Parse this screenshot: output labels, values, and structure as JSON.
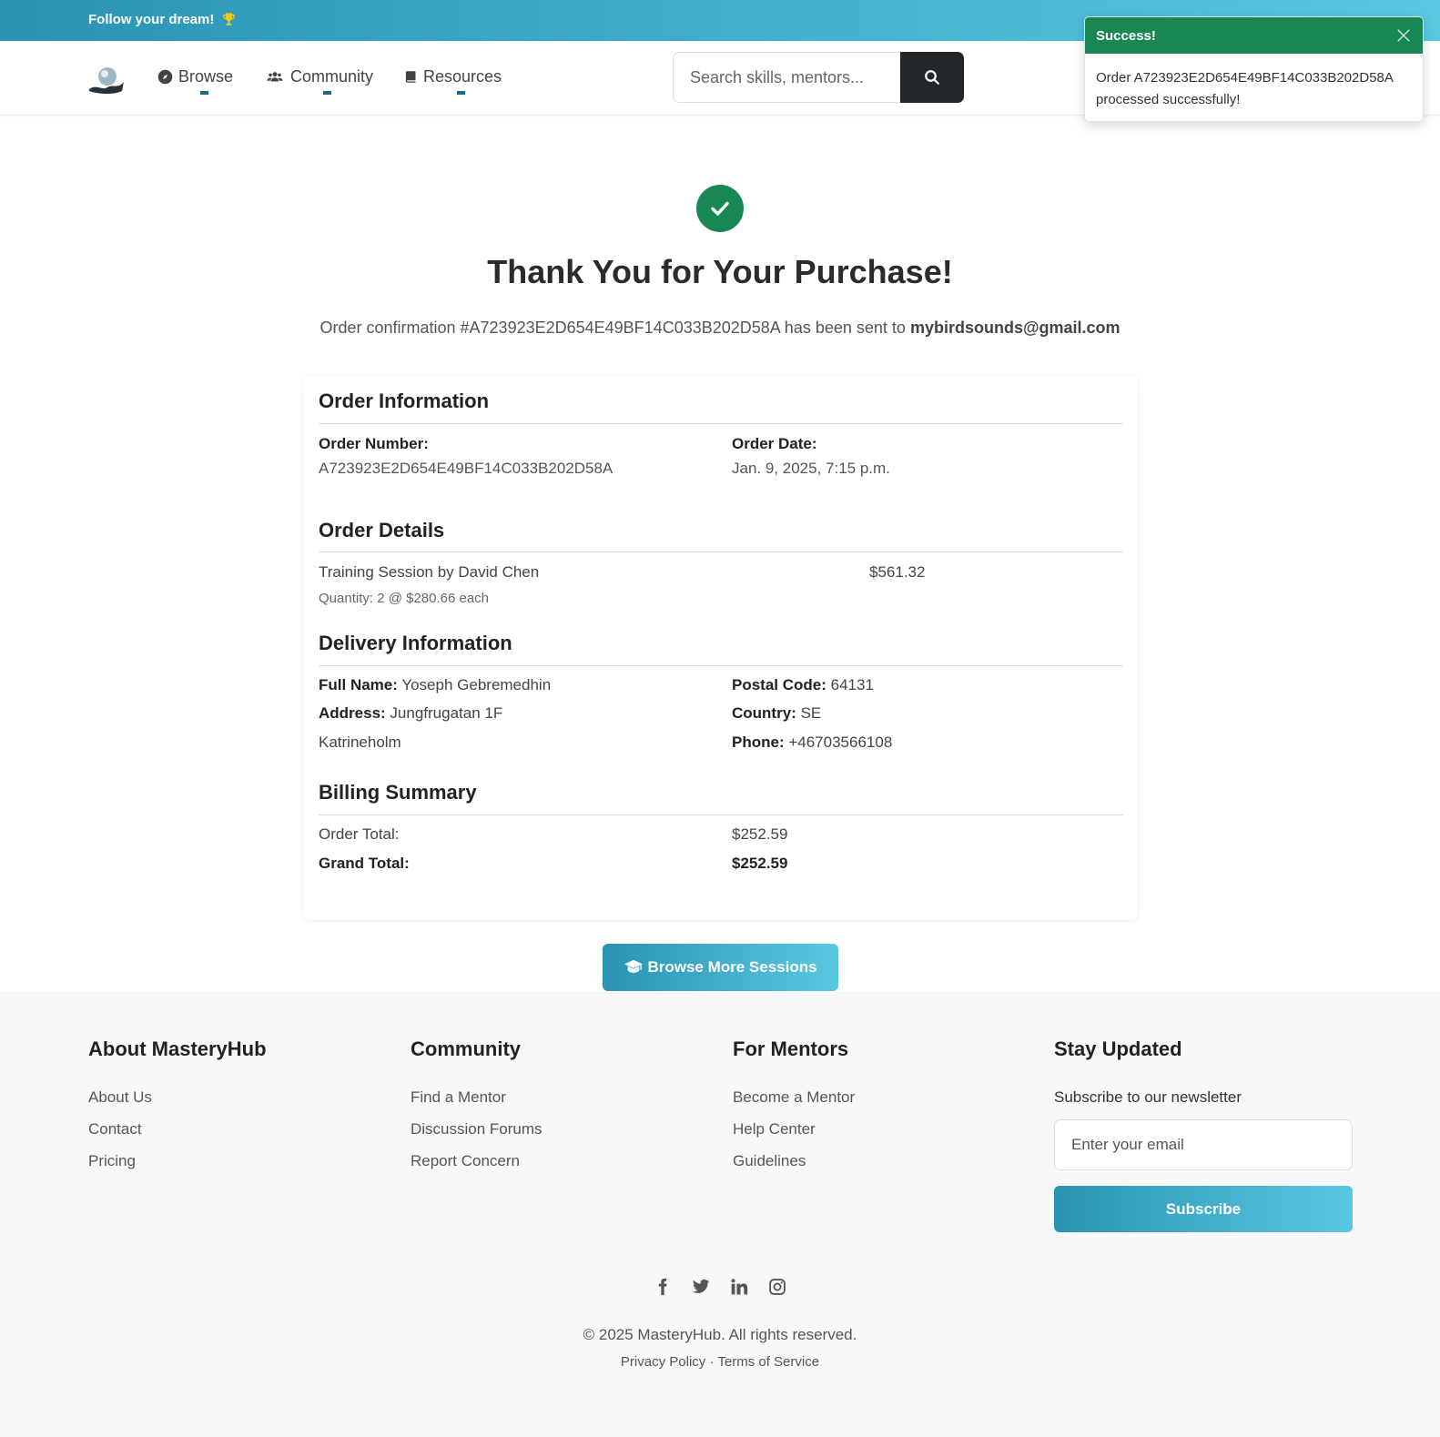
{
  "topbar": {
    "promo_text": "Follow your dream!",
    "trophy_icon": "trophy-icon"
  },
  "nav": {
    "browse": "Browse",
    "community": "Community",
    "resources": "Resources",
    "search_placeholder": "Search skills, mentors..."
  },
  "toast": {
    "title": "Success!",
    "message": "Order A723923E2D654E49BF14C033B202D58A processed successfully!"
  },
  "hero": {
    "title": "Thank You for Your Purchase!",
    "confirm_prefix": "Order confirmation #A723923E2D654E49BF14C033B202D58A has been sent to",
    "email": "mybirdsounds@gmail.com"
  },
  "order_info": {
    "title": "Order Information",
    "number_label": "Order Number:",
    "number": "A723923E2D654E49BF14C033B202D58A",
    "date_label": "Order Date:",
    "date": "Jan. 9, 2025, 7:15 p.m."
  },
  "order_details": {
    "title": "Order Details",
    "item_name": "Training Session by David Chen",
    "item_price": "$561.32",
    "item_qty": "Quantity: 2 @ $280.66 each"
  },
  "delivery": {
    "title": "Delivery Information",
    "full_name_label": "Full Name:",
    "full_name": "Yoseph Gebremedhin",
    "address_label": "Address:",
    "address": "Jungfrugatan 1F",
    "city": "Katrineholm",
    "postal_label": "Postal Code:",
    "postal": "64131",
    "country_label": "Country:",
    "country": "SE",
    "phone_label": "Phone:",
    "phone": "+46703566108"
  },
  "billing": {
    "title": "Billing Summary",
    "order_total_label": "Order Total:",
    "order_total": "$252.59",
    "grand_total_label": "Grand Total:",
    "grand_total": "$252.59"
  },
  "cta": {
    "browse_more": "Browse More Sessions"
  },
  "footer": {
    "about": {
      "title": "About MasteryHub",
      "links": [
        "About Us",
        "Contact",
        "Pricing"
      ]
    },
    "community": {
      "title": "Community",
      "links": [
        "Find a Mentor",
        "Discussion Forums",
        "Report Concern"
      ]
    },
    "mentors": {
      "title": "For Mentors",
      "links": [
        "Become a Mentor",
        "Help Center",
        "Guidelines"
      ]
    },
    "stay": {
      "title": "Stay Updated",
      "label": "Subscribe to our newsletter",
      "placeholder": "Enter your email",
      "button": "Subscribe"
    },
    "copyright": "© 2025 MasteryHub. All rights reserved.",
    "privacy": "Privacy Policy",
    "separator": "·",
    "terms": "Terms of Service"
  },
  "colors": {
    "accent": "#2a93b4",
    "accent_light": "#5ac8e2",
    "success": "#198754",
    "dark": "#23262b"
  }
}
